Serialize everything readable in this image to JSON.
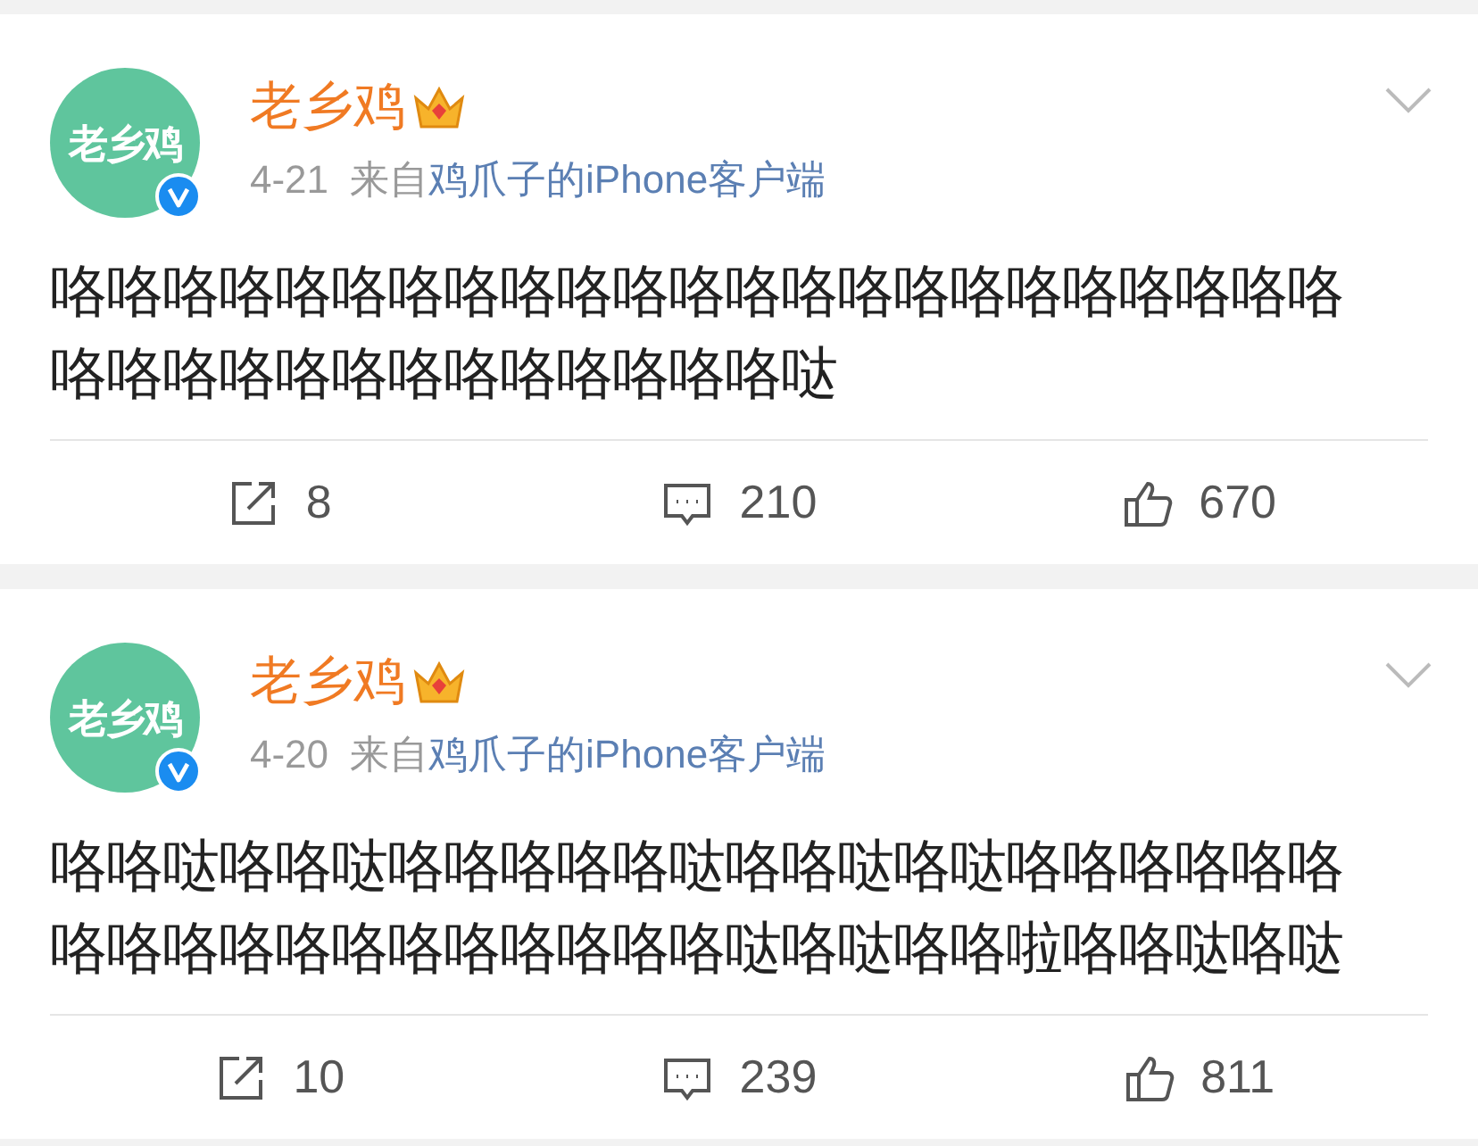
{
  "posts": [
    {
      "avatar_text": "老乡鸡",
      "verified": true,
      "author": "老乡鸡",
      "date": "4-21",
      "via": "来自",
      "source": "鸡爪子的iPhone客户端",
      "body": [
        "咯咯咯咯咯咯咯咯咯咯咯咯咯咯咯咯咯咯咯咯咯咯咯",
        "咯咯咯咯咯咯咯咯咯咯咯咯咯哒"
      ],
      "actions": [
        {
          "kind": "repost",
          "count": "8"
        },
        {
          "kind": "comment",
          "count": "210"
        },
        {
          "kind": "like",
          "count": "670"
        }
      ]
    },
    {
      "avatar_text": "老乡鸡",
      "verified": true,
      "author": "老乡鸡",
      "date": "4-20",
      "via": "来自",
      "source": "鸡爪子的iPhone客户端",
      "body": [
        "咯咯哒咯咯哒咯咯咯咯咯哒咯咯哒咯哒咯咯咯咯咯咯",
        "咯咯咯咯咯咯咯咯咯咯咯咯哒咯哒咯咯啦咯咯哒咯哒"
      ],
      "actions": [
        {
          "kind": "repost",
          "count": "10"
        },
        {
          "kind": "comment",
          "count": "239"
        },
        {
          "kind": "like",
          "count": "811"
        }
      ]
    }
  ]
}
